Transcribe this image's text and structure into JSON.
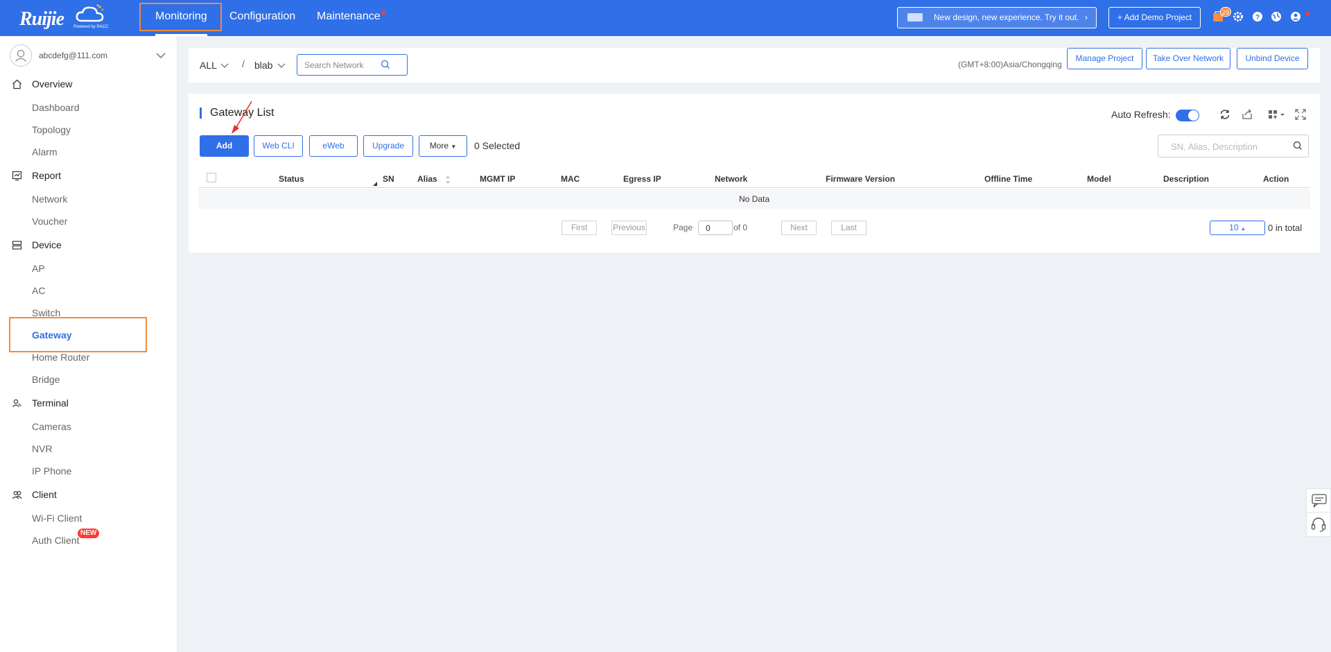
{
  "brand": {
    "logo_text": "Ruijie",
    "powered_by": "Powered by RACC"
  },
  "topnav": {
    "items": [
      "Monitoring",
      "Configuration",
      "Maintenance"
    ],
    "active": "Monitoring"
  },
  "topbar": {
    "promo_text": "New design, new experience. Try it out.",
    "demo_label": "+ Add Demo Project",
    "notification_count": "29"
  },
  "colors": {
    "primary": "#2f6fe7",
    "highlight": "#f08a3c",
    "alert": "#ff3b30"
  },
  "sidebar": {
    "account_email": "abcdefg@111.com",
    "sections": [
      {
        "label": "Overview",
        "icon": "home-icon",
        "items": [
          "Dashboard",
          "Topology",
          "Alarm"
        ]
      },
      {
        "label": "Report",
        "icon": "report-icon",
        "items": [
          "Network",
          "Voucher"
        ]
      },
      {
        "label": "Device",
        "icon": "device-icon",
        "items": [
          "AP",
          "AC",
          "Switch",
          "Gateway",
          "Home Router",
          "Bridge"
        ]
      },
      {
        "label": "Terminal",
        "icon": "terminal-icon",
        "items": [
          "Cameras",
          "NVR",
          "IP Phone"
        ]
      },
      {
        "label": "Client",
        "icon": "client-icon",
        "items": [
          "Wi-Fi Client",
          "Auth Client"
        ]
      }
    ],
    "active_item": "Gateway",
    "new_badge": "NEW"
  },
  "filter": {
    "scope": "ALL",
    "separator": "/",
    "network": "blab",
    "search_placeholder": "Search Network",
    "timezone": "(GMT+8:00)Asia/Chongqing",
    "manage_project": "Manage Project",
    "take_over": "Take Over Network",
    "unbind": "Unbind Device"
  },
  "panel": {
    "title": "Gateway List",
    "auto_refresh_label": "Auto Refresh:",
    "auto_refresh_on": true,
    "buttons": {
      "add": "Add",
      "web_cli": "Web CLI",
      "eweb": "eWeb",
      "upgrade": "Upgrade",
      "more": "More"
    },
    "selected": "0 Selected",
    "search_placeholder": "SN, Alias, Description"
  },
  "table": {
    "columns": [
      "Status",
      "SN",
      "Alias",
      "MGMT IP",
      "MAC",
      "Egress IP",
      "Network",
      "Firmware Version",
      "Offline Time",
      "Model",
      "Description",
      "Action"
    ],
    "rows": [],
    "empty_text": "No Data"
  },
  "pagination": {
    "first": "First",
    "previous": "Previous",
    "page_label": "Page",
    "page_value": "0",
    "of_label": "of 0",
    "next": "Next",
    "last": "Last",
    "page_size": "10",
    "total": "0 in total"
  }
}
